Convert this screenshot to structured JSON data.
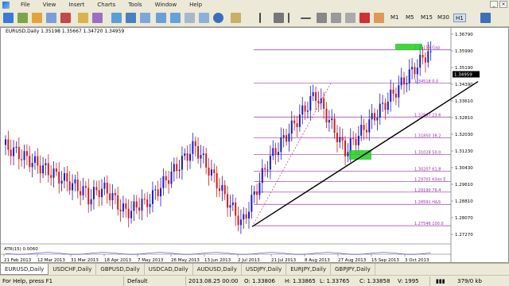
{
  "menu": {
    "items": [
      "File",
      "View",
      "Insert",
      "Charts",
      "Tools",
      "Window",
      "Help"
    ]
  },
  "toolbar": {
    "timeframes": [
      "M1",
      "M5",
      "M15",
      "M30",
      "H1"
    ],
    "active_timeframe": "H1"
  },
  "chart": {
    "header": "EURUSD,Daily  1.35198  1.35667  1.34720  1.34959",
    "price_labels": [
      "1.36790",
      "1.35990",
      "1.35190",
      "1.34390",
      "1.33610",
      "1.32810",
      "1.32030",
      "1.31230",
      "1.30430",
      "1.29610",
      "1.28810",
      "1.28070",
      "1.27270"
    ],
    "current_price": "1.34959",
    "fib_levels": [
      {
        "label": "1.36155 Gap",
        "price": 1.36155
      },
      {
        "label": "1.34518 0.0",
        "price": 1.34518
      },
      {
        "label": "1.32867 23.6",
        "price": 1.32867
      },
      {
        "label": "1.31850 38.2",
        "price": 1.3185
      },
      {
        "label": "1.31028 50.0",
        "price": 1.31028
      },
      {
        "label": "1.30207 61.8",
        "price": 1.30207
      },
      {
        "label": "1.29705 Killer E",
        "price": 1.29705
      },
      {
        "label": "1.29190 76.4",
        "price": 1.2919
      },
      {
        "label": "1.28591 H&S",
        "price": 1.28591
      },
      {
        "label": "1.27546 100.0",
        "price": 1.27546
      }
    ],
    "indicator_label": "ATR(15) 0.0060",
    "date_labels": [
      "21 Feb 2013",
      "12 Mar 2013",
      "31 Mar 2013",
      "18 Apr 2013",
      "7 May 2013",
      "26 May 2013",
      "13 Jun 2013",
      "2 Jul 2013",
      "21 Jul 2013",
      "8 Aug 2013",
      "27 Aug 2013",
      "15 Sep 2013",
      "3 Oct 2013"
    ],
    "colors": {
      "bull": "#1a1acc",
      "bear": "#d21b1b",
      "fib": "#9933aa",
      "trend": "#000000",
      "highlight": "#22cc22"
    }
  },
  "tabs": [
    "EURUSD,Daily",
    "USDCHF,Daily",
    "GBPUSD,Daily",
    "USDCAD,Daily",
    "AUDUSD,Daily",
    "USDJPY,Daily",
    "EURJPY,Daily",
    "GBPJPY,Daily"
  ],
  "status": {
    "help": "For Help, press F1",
    "profile": "Default",
    "datetime": "2013.08.25 00:00",
    "open": "O: 1.33806",
    "high": "H: 1.33865",
    "low": "L: 1.33765",
    "close": "C: 1.33858",
    "volume": "V: 1995",
    "traffic": "379/0 kb"
  }
}
